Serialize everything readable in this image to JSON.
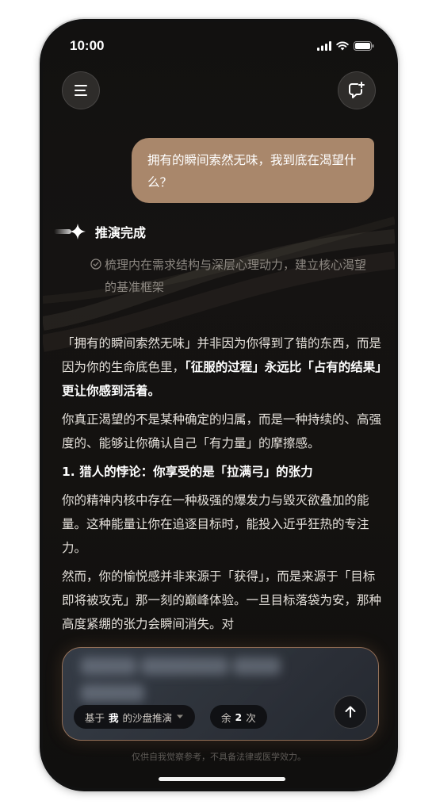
{
  "status_bar": {
    "time": "10:00"
  },
  "header": {
    "menu_icon": "hamburger-menu-icon",
    "new_chat_icon": "new-chat-plus-icon"
  },
  "conversation": {
    "user_message": "拥有的瞬间索然无味，我到底在渴望什么？",
    "deduction": {
      "title": "推演完成",
      "step": "梳理内在需求结构与深层心理动力，建立核心渴望的基准框架"
    },
    "answer": {
      "p1_a": "「拥有的瞬间索然无味」并非因为你得到了错的东西，而是因为你的生命底色里，",
      "p1_bold": "「征服的过程」永远比「占有的结果」更让你感到活着。",
      "p2": "你真正渴望的不是某种确定的归属，而是一种持续的、高强度的、能够让你确认自己「有力量」的摩擦感。",
      "h1": "1. 猎人的悖论：你享受的是「拉满弓」的张力",
      "p3": "你的精神内核中存在一种极强的爆发力与毁灭欲叠加的能量。这种能量让你在追逐目标时，能投入近乎狂热的专注力。",
      "p4": "然而，你的愉悦感并非来源于「获得」，而是来源于「目标即将被攻克」那一刻的巅峰体验。一旦目标落袋为安，那种高度紧绷的张力会瞬间消失。对"
    }
  },
  "composer": {
    "mode_prefix": "基于",
    "mode_bold": "我",
    "mode_suffix": "的沙盘推演",
    "remaining_prefix": "余",
    "remaining_count": "2",
    "remaining_suffix": "次",
    "send_icon": "arrow-up-icon"
  },
  "disclaimer": "仅供自我觉察参考，不具备法律或医学效力。",
  "colors": {
    "background": "#131110",
    "user_bubble": "#a9876b",
    "composer_border": "#e6a06e"
  }
}
